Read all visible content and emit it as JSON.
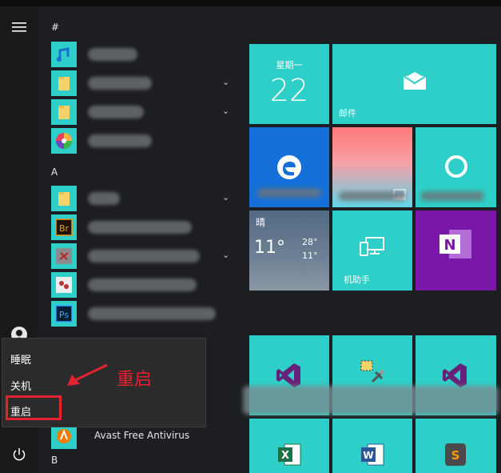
{
  "start_menu": {
    "rail": {
      "menu_icon": "hamburger-icon",
      "user_icon": "user-avatar-icon",
      "power_icon": "power-icon"
    },
    "app_list": {
      "sections": [
        "#",
        "A",
        "B"
      ],
      "apps": [
        {
          "icon": "music-app-icon",
          "label": "",
          "color": "#2dcfc8",
          "chevron": false
        },
        {
          "icon": "folder-icon",
          "label": "",
          "color": "#2dcfc8",
          "chevron": true
        },
        {
          "icon": "folder-icon",
          "label": "",
          "color": "#2dcfc8",
          "chevron": true
        },
        {
          "icon": "pinwheel-app-icon",
          "label": "",
          "color": "#2dcfc8",
          "chevron": false
        },
        {
          "icon": "folder-icon",
          "label": "",
          "color": "#2dcfc8",
          "chevron": true
        },
        {
          "icon": "bridge-app-icon",
          "label": "",
          "color": "#2dcfc8",
          "chevron": false
        },
        {
          "icon": "app-icon",
          "label": "",
          "color": "#2dcfc8",
          "chevron": true
        },
        {
          "icon": "app-icon",
          "label": "",
          "color": "#2dcfc8",
          "chevron": false
        },
        {
          "icon": "photoshop-app-icon",
          "label": "",
          "color": "#2dcfc8",
          "chevron": false
        },
        {
          "icon": "avast-icon",
          "label": "Avast Free Antivirus",
          "color": "#2dcfc8",
          "chevron": false
        }
      ],
      "abbr_br": "Br",
      "abbr_ps": "Ps"
    },
    "power_menu": {
      "items": [
        "睡眠",
        "关机",
        "重启"
      ],
      "highlighted": "重启",
      "highlight_color": "#e3232f"
    },
    "annotation": {
      "text": "重启",
      "color": "#e3232f"
    },
    "tiles": {
      "calendar": {
        "day_name": "星期一",
        "day_number": "22"
      },
      "mail": {
        "label": "邮件",
        "icon": "mail-icon"
      },
      "edge": {
        "icon": "edge-icon"
      },
      "photo": {
        "icon": "photo-icon"
      },
      "cortana": {
        "icon": "cortana-icon"
      },
      "weather": {
        "condition": "晴",
        "current": "11°",
        "high": "28°",
        "low": "11°"
      },
      "phone": {
        "label": "机助手",
        "icon": "phone-pc-icon"
      },
      "onenote": {
        "icon": "onenote-icon",
        "letter": "N"
      },
      "vs1": {
        "icon": "visual-studio-icon"
      },
      "tools": {
        "icon": "tools-icon"
      },
      "vs2": {
        "icon": "visual-studio-icon"
      },
      "excel": {
        "icon": "excel-icon",
        "letter": "X"
      },
      "word": {
        "icon": "word-icon",
        "letter": "W"
      },
      "sublime": {
        "icon": "sublime-icon",
        "letter": "S"
      }
    },
    "colors": {
      "tile_teal": "#2dcfc8",
      "edge_blue": "#1470d8",
      "onenote_purple": "#7a16a8",
      "menu_bg": "#2b2b2b"
    }
  }
}
